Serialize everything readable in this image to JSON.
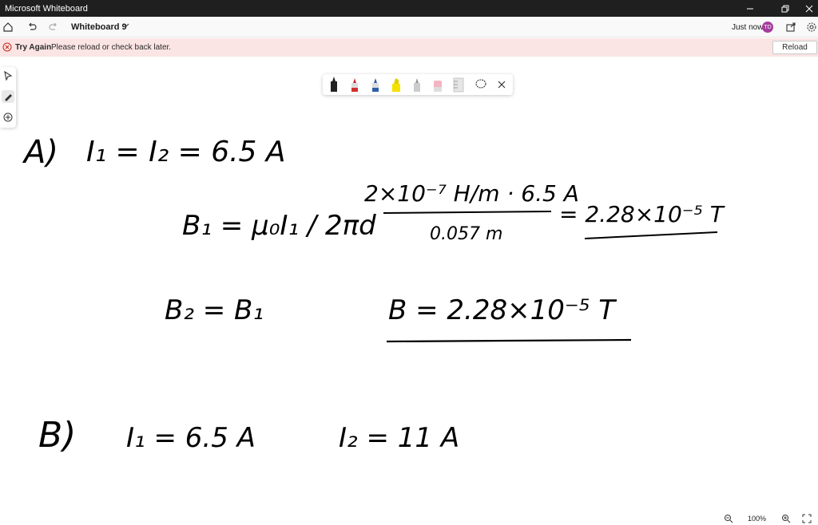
{
  "window": {
    "title": "Microsoft Whiteboard"
  },
  "toolbar": {
    "board_name": "Whiteboard 9",
    "status": "Just now",
    "avatar_initials": "TD"
  },
  "banner": {
    "heading": "Try Again",
    "message": "Please reload or check back later.",
    "reload_label": "Reload"
  },
  "zoom": {
    "level": "100%"
  },
  "colors": {
    "titlebar": "#1f1f1f",
    "banner_bg": "#fbe4e4",
    "banner_icon": "#c42b1c",
    "avatar": "#a53c9b",
    "pen_red": "#d32f2f",
    "pen_blue": "#2f5fa8",
    "pen_yellow": "#f5e100"
  },
  "whiteboard": {
    "part_a": {
      "label": "A)",
      "given": "I₁ = I₂ = 6.5 A",
      "b1_left": "B₁ = μ₀I₁ / 2πd",
      "b1_num_line": "2×10⁻⁷ H/m · 6.5 A",
      "b1_den": "0.057 m",
      "b1_result": "= 2.28×10⁻⁵ T",
      "b2_eq": "B₂ = B₁",
      "b_final": "B = 2.28×10⁻⁵ T"
    },
    "part_b": {
      "label": "B)",
      "i1": "I₁ = 6.5 A",
      "i2": "I₂ = 11 A"
    }
  }
}
